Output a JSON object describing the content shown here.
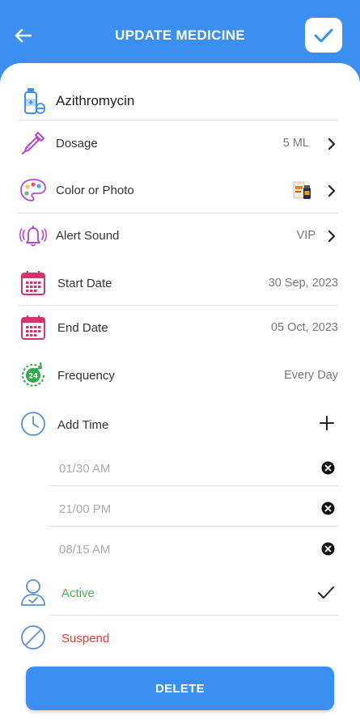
{
  "header": {
    "title": "UPDATE MEDICINE"
  },
  "medicine": {
    "name": "Azithromycin"
  },
  "fields": {
    "dosage": {
      "label": "Dosage",
      "value": "5 ML"
    },
    "color": {
      "label": "Color or Photo"
    },
    "alert": {
      "label": "Alert Sound",
      "value": "VIP"
    },
    "start": {
      "label": "Start Date",
      "value": "30 Sep, 2023"
    },
    "end": {
      "label": "End Date",
      "value": "05 Oct, 2023"
    },
    "frequency": {
      "label": "Frequency",
      "value": "Every Day"
    },
    "add_time": {
      "label": "Add Time"
    }
  },
  "times": [
    "01/30 AM",
    "21/00 PM",
    "08/15 AM"
  ],
  "status": {
    "active_label": "Active",
    "suspend_label": "Suspend"
  },
  "delete_label": "DELETE",
  "colors": {
    "primary": "#3a8ff0",
    "active": "#4caf50",
    "suspend": "#e53935"
  }
}
